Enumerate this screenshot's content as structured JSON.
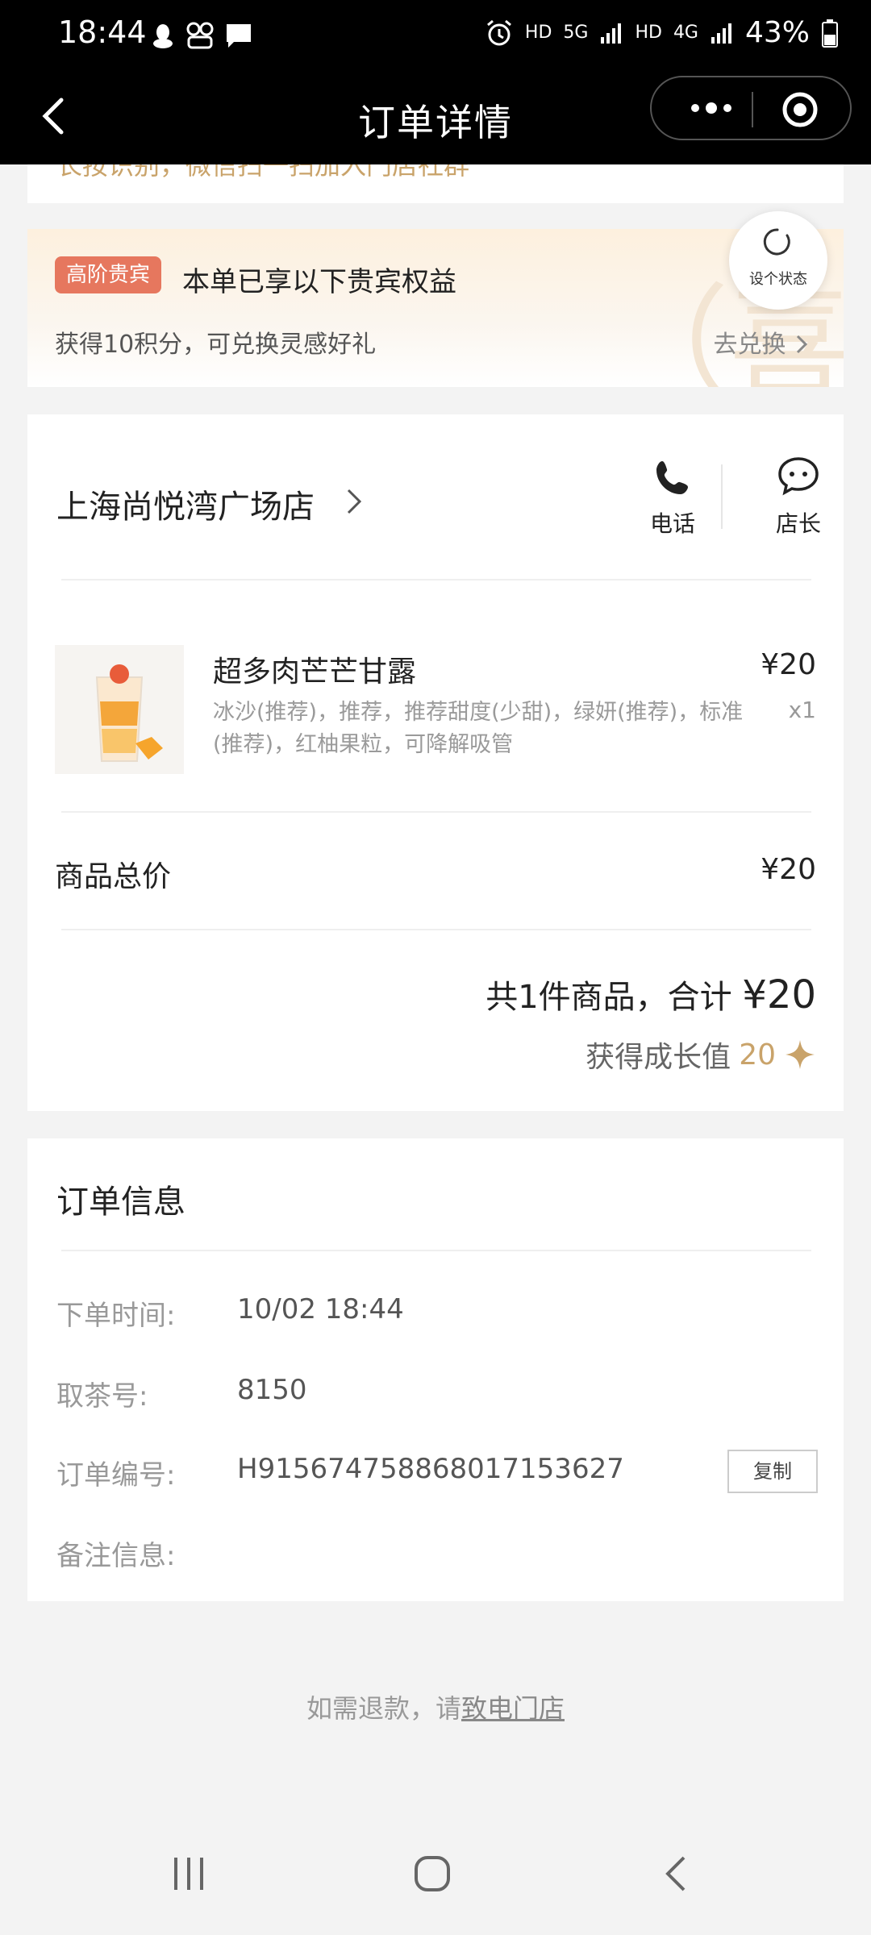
{
  "status_bar": {
    "time": "18:44",
    "net1": "HD",
    "net2": "5G",
    "net3": "HD",
    "net4": "4G",
    "battery": "43%"
  },
  "nav": {
    "title": "订单详情"
  },
  "banner_cut_text": "长按识别，微信扫一扫加入门店社群",
  "vip": {
    "badge": "高阶贵宾",
    "title": "本单已享以下贵宾权益",
    "desc": "获得10积分，可兑换灵感好礼",
    "redeem": "去兑换",
    "watermark": "（喜）"
  },
  "status_fab": {
    "label": "设个状态"
  },
  "store": {
    "name": "上海尚悦湾广场店",
    "call_label": "电话",
    "manager_label": "店长"
  },
  "product": {
    "name": "超多肉芒芒甘露",
    "options": "冰沙(推荐)，推荐，推荐甜度(少甜)，绿妍(推荐)，标准(推荐)，红柚果粒，可降解吸管",
    "price": "¥20",
    "qty": "x1"
  },
  "totals": {
    "goods_total_label": "商品总价",
    "goods_total_value": "¥20",
    "summary_prefix": "共1件商品，合计 ",
    "summary_amount": "¥20",
    "growth_label": "获得成长值",
    "growth_value": "20"
  },
  "order_info": {
    "title": "订单信息",
    "rows": [
      {
        "key": "下单时间:",
        "value": "10/02 18:44"
      },
      {
        "key": "取茶号:",
        "value": "8150"
      },
      {
        "key": "订单编号:",
        "value": "H915674758868017153627"
      },
      {
        "key": "备注信息:",
        "value": ""
      }
    ],
    "copy_label": "复制"
  },
  "refund": {
    "prefix": "如需退款，请",
    "link": "致电门店"
  },
  "colors": {
    "accent_gold": "#c9a36a",
    "badge_red": "#e6775e"
  }
}
